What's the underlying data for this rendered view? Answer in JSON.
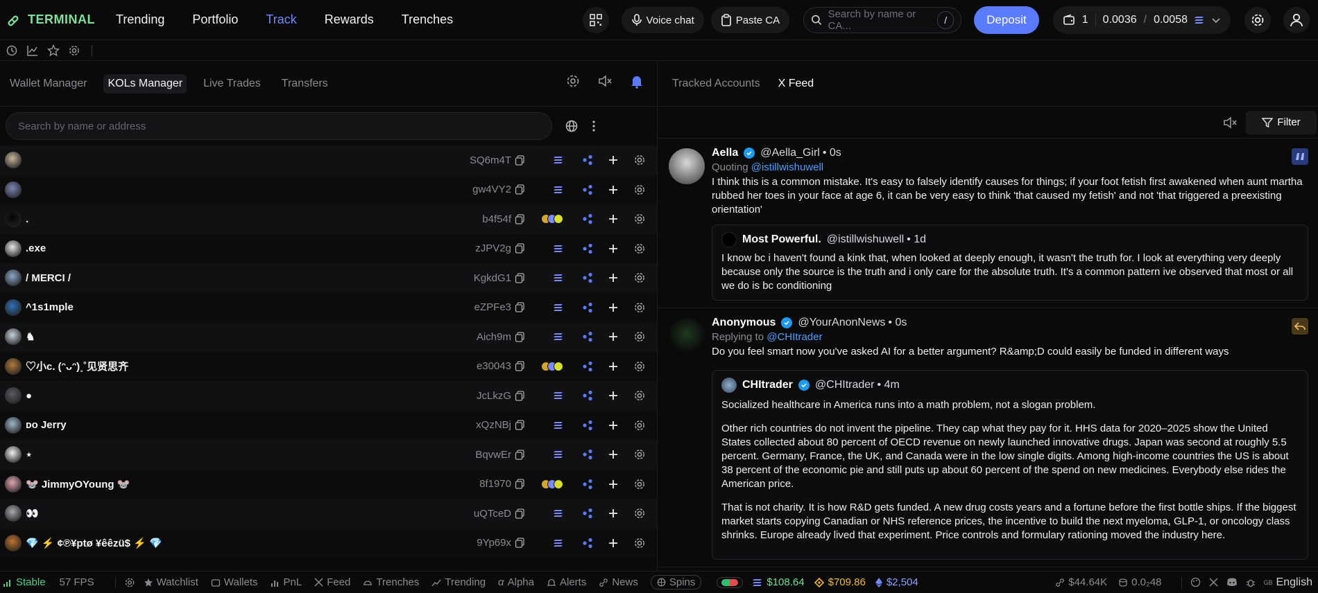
{
  "app": {
    "brand": "TERMINAL"
  },
  "nav": {
    "items": [
      "Trending",
      "Portfolio",
      "Track",
      "Rewards",
      "Trenches"
    ],
    "active": "Track"
  },
  "topbar": {
    "voice_chat": "Voice chat",
    "paste_ca": "Paste CA",
    "search_placeholder": "Search by name or CA...",
    "search_shortcut": "/",
    "deposit": "Deposit",
    "wallet_count": "1",
    "bal1": "0.0036",
    "bal_sep": "/",
    "bal2": "0.0058"
  },
  "left": {
    "tabs": [
      "Wallet Manager",
      "KOLs Manager",
      "Live Trades",
      "Transfers"
    ],
    "active_tab": "KOLs Manager",
    "search_placeholder": "Search by name or address",
    "rows": [
      {
        "name": "",
        "addr": "SQ6m4T",
        "badges": false,
        "color": "#c9b59a"
      },
      {
        "name": "",
        "addr": "gw4VY2",
        "badges": false,
        "color": "#7c86b8"
      },
      {
        "name": ".",
        "addr": "b4f54f",
        "badges": true,
        "color": "#050505"
      },
      {
        "name": ".exe",
        "addr": "zJPV2g",
        "badges": false,
        "color": "#e8e8e8"
      },
      {
        "name": "/ MERCI /",
        "addr": "KgkdG1",
        "badges": false,
        "color": "#8aa7c8"
      },
      {
        "name": "^1s1mple",
        "addr": "eZPFe3",
        "badges": false,
        "color": "#2f6fb6"
      },
      {
        "name": "♞",
        "addr": "Aich9m",
        "badges": false,
        "color": "#c8d2e0"
      },
      {
        "name": "♡小c. (ᵔᴗᵔ)˳˚见贤思齐",
        "addr": "e30043",
        "badges": true,
        "color": "#b07a3a"
      },
      {
        "name": "●",
        "addr": "JcLkzG",
        "badges": false,
        "color": "#5a5a60"
      },
      {
        "name": "ᴅᴏ Jerry",
        "addr": "xQzNBj",
        "badges": false,
        "color": "#9fb6c8"
      },
      {
        "name": "⋆",
        "addr": "BqvwEr",
        "badges": false,
        "color": "#f0f0f0"
      },
      {
        "name": "🐭 JimmyOYoung 🐭",
        "addr": "8f1970",
        "badges": true,
        "color": "#e2a6b0"
      },
      {
        "name": "👀",
        "addr": "uQTceD",
        "badges": false,
        "color": "#a8a8ad"
      },
      {
        "name": "💎 ⚡ ¢℗¥ptø ¥êêzü$ ⚡ 💎",
        "addr": "9Yp69x",
        "badges": false,
        "color": "#c0742e"
      }
    ]
  },
  "right": {
    "tabs": [
      "Tracked Accounts",
      "X Feed"
    ],
    "active_tab": "X Feed",
    "filter": "Filter",
    "posts": [
      {
        "name": "Aella",
        "handle": "@Aella_Girl",
        "time": "• 0s",
        "meta_label": "Quoting",
        "meta_link": "@istillwishuwell",
        "text": "I think this is a common mistake. It's easy to falsely identify causes for things; if your foot fetish first awakened when aunt martha rubbed her toes in your face at age 6, it can be very easy to think 'that caused my fetish' and not 'that triggered a preexisting orientation'",
        "quote": {
          "name": "Most Powerful.",
          "handle": "@istillwishuwell",
          "time": "• 1d",
          "text": "I know bc i haven't found a kink that, when looked at deeply enough, it wasn't the truth for. I look at everything very deeply because only the source is the truth and i only care for the absolute truth. It's a common pattern ive observed that most or all we do is bc conditioning"
        }
      },
      {
        "name": "Anonymous",
        "handle": "@YourAnonNews",
        "time": "• 0s",
        "meta_label": "Replying to",
        "meta_link": "@CHItrader",
        "text": "Do you feel smart now you've asked AI for a better argument? R&amp;D could easily be funded in different ways",
        "quote": {
          "name": "CHItrader",
          "handle": "@CHItrader",
          "time": "• 4m",
          "p1": "Socialized healthcare in America runs into a math problem, not a slogan problem.",
          "p2": "Other rich countries do not invent the pipeline. They cap what they pay for it. HHS data for 2020–2025 show the United States collected about 80 percent of OECD revenue on newly launched innovative drugs. Japan was second at roughly 5.5 percent. Germany, France, the UK, and Canada were in the low single digits. Among high-income countries the US is about 38 percent of the economic pie and still puts up about 60 percent of the spend on new medicines. Everybody else rides the American price.",
          "p3": "That is not charity. It is how R&D gets funded. A new drug costs years and a fortune before the first bottle ships. If the biggest market starts copying Canadian or NHS reference prices, the incentive to build the next myeloma, GLP-1, or oncology class shrinks. Europe already lived that experiment. Price controls and formulary rationing moved the industry here."
        }
      }
    ]
  },
  "footer": {
    "status": "Stable",
    "fps": "57 FPS",
    "items": [
      "Watchlist",
      "Wallets",
      "PnL",
      "Feed",
      "Trenches",
      "Trending",
      "Alpha",
      "Alerts",
      "News"
    ],
    "spins": "Spins",
    "sol_price": "$108.64",
    "bnb_price": "$709.86",
    "eth_price": "$2,504",
    "volume": "$44.64K",
    "gas": "0.0₂48",
    "language": "English",
    "lang_code": "GB"
  },
  "colors": {
    "accent": "#5b7bff",
    "brand_green": "#7ee19a",
    "link": "#4d9fff",
    "stable": "#4fd08a"
  }
}
